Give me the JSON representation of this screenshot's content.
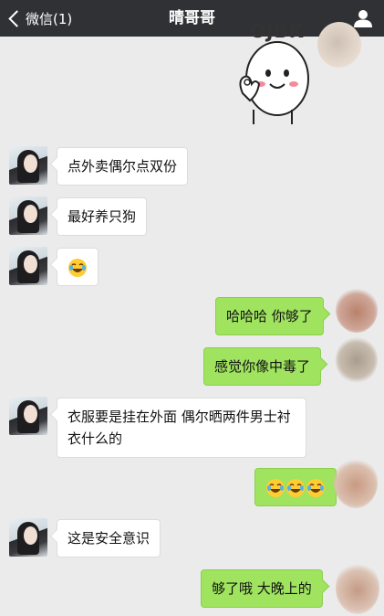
{
  "header": {
    "back_label": "微信(1)",
    "title": "晴哥哥",
    "bg_color": "#2f3134"
  },
  "sticker": {
    "caption": "OJBK",
    "icon": "ok-hand-cartoon-sticker"
  },
  "messages": [
    {
      "side": "in",
      "text": "点外卖偶尔点双份"
    },
    {
      "side": "in",
      "text": "最好养只狗"
    },
    {
      "side": "in",
      "text": "",
      "emoji": [
        "crying-laughing-emoji"
      ]
    },
    {
      "side": "out",
      "text": "哈哈哈 你够了"
    },
    {
      "side": "out",
      "text": "感觉你像中毒了"
    },
    {
      "side": "in",
      "text": "衣服要是挂在外面 偶尔晒两件男士衬衣什么的"
    },
    {
      "side": "out",
      "text": "",
      "emoji": [
        "crying-laughing-emoji",
        "crying-laughing-emoji",
        "crying-laughing-emoji"
      ]
    },
    {
      "side": "in",
      "text": "这是安全意识"
    },
    {
      "side": "out",
      "text": "够了哦 大晚上的"
    }
  ],
  "colors": {
    "out_bubble": "#9fe35f",
    "in_bubble": "#ffffff",
    "background": "#ebebeb"
  }
}
